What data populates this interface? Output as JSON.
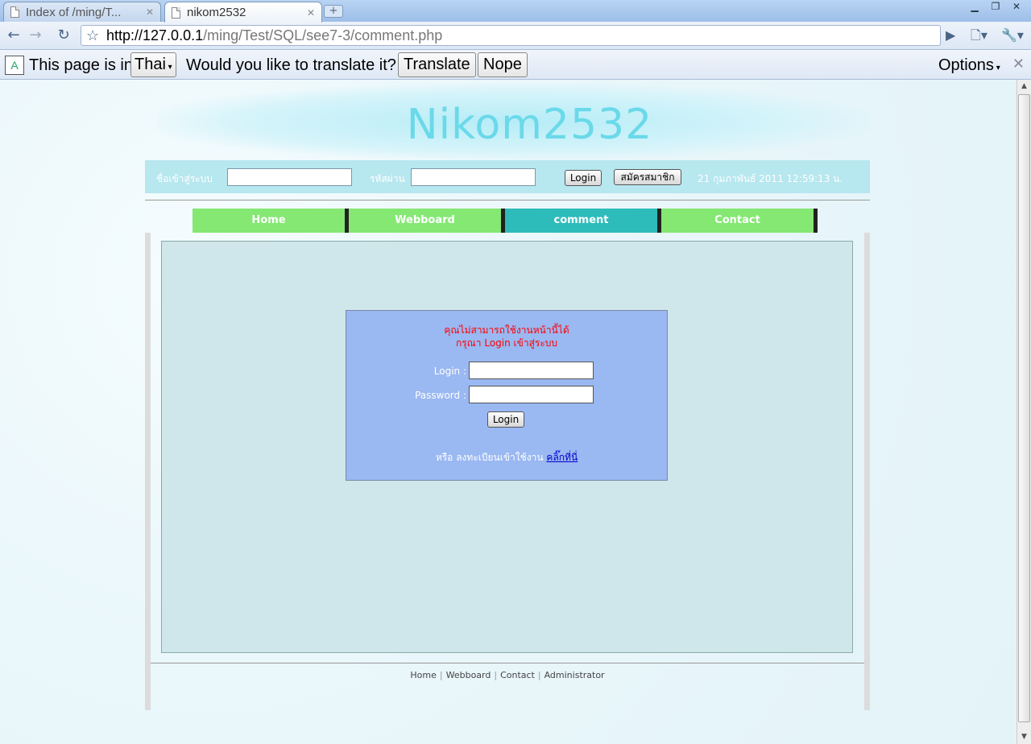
{
  "browser": {
    "tabs": [
      {
        "label": "Index of /ming/T...",
        "active": false
      },
      {
        "label": "nikom2532",
        "active": true
      }
    ],
    "url_host": "http://127.0.0.1",
    "url_path": "/ming/Test/SQL/see7-3/comment.php"
  },
  "translate_bar": {
    "prefix": "This page is in",
    "language": "Thai",
    "question": "Would you like to translate it?",
    "translate_label": "Translate",
    "nope_label": "Nope",
    "options_label": "Options"
  },
  "site": {
    "title": "Nikom2532",
    "username_label": "ชื่อเข้าสู่ระบบ",
    "password_label": "รหัสผ่าน",
    "login_button": "Login",
    "register_button": "สมัครสมาชิก",
    "datetime": "21 กุมภาพันธ์ 2011 12:59:13 น."
  },
  "menu": [
    {
      "label": "Home",
      "active": false
    },
    {
      "label": "Webboard",
      "active": false
    },
    {
      "label": "comment",
      "active": true
    },
    {
      "label": "Contact",
      "active": false
    }
  ],
  "login_box": {
    "warning_line1": "คุณไม่สามารถใช้งานหน้านี้ได้",
    "warning_line2": "กรุณา Login เข้าสู่ระบบ",
    "login_label": "Login :",
    "password_label": "Password :",
    "submit_label": "Login",
    "register_prefix": "หรือ ลงทะเบียนเข้าใช้งาน",
    "register_link": "คลิ๊กที่นี่"
  },
  "footer": {
    "links": [
      "Home",
      "Webboard",
      "Contact",
      "Administrator"
    ]
  },
  "colors": {
    "accent_menu": "#84e873",
    "active_menu": "#2ebcba",
    "warning_text": "#ff0000",
    "title_color": "#6ad9e9"
  }
}
